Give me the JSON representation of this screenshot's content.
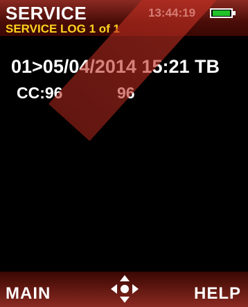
{
  "header": {
    "title": "SERVICE",
    "time": "13:44:19",
    "battery_level": 1.0,
    "battery_color": "#22c22a",
    "subtitle": "SERVICE LOG 1 of 1"
  },
  "log": {
    "line1": "01>05/04/2014 15:21 TB",
    "line2_label": "CC:96",
    "line2_value": "96"
  },
  "footer": {
    "left_softkey": "MAIN",
    "right_softkey": "HELP",
    "center_icon": "four-way-nav-icon"
  },
  "colors": {
    "header_bg": "#4a0d08",
    "subtitle": "#ffd21f",
    "text": "#ffffff",
    "screen_bg": "#000000"
  }
}
